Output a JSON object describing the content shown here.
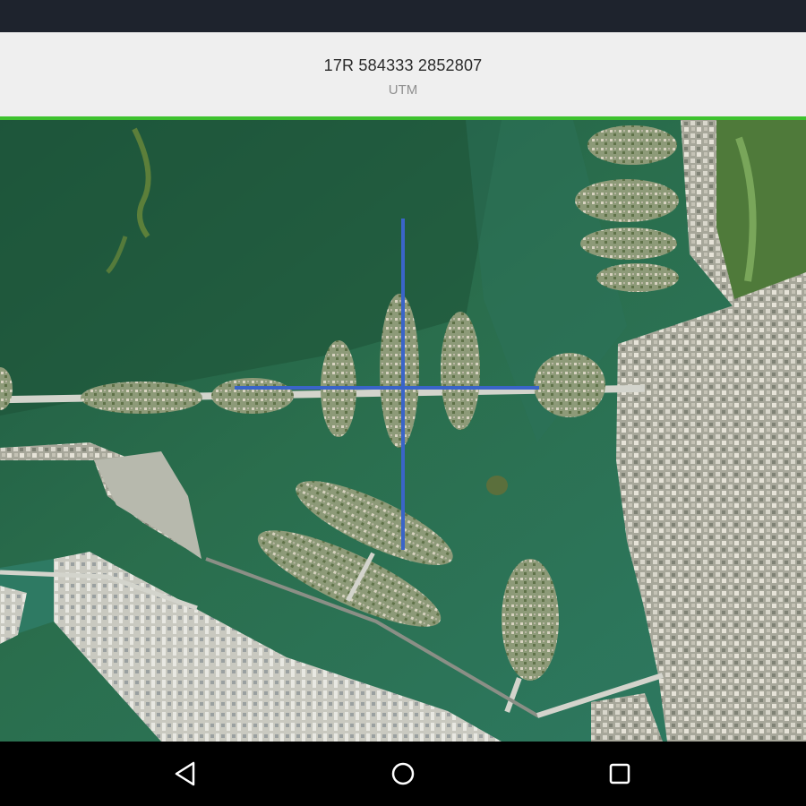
{
  "coordinates": {
    "value": "17R 584333 2852807",
    "system": "UTM"
  },
  "colors": {
    "accent": "#3ec22f",
    "crosshair": "#3a64c8",
    "status_bar": "#1e232d",
    "panel_bg": "#efefef"
  },
  "navigation": {
    "back_icon": "triangle-back-icon",
    "home_icon": "circle-home-icon",
    "recents_icon": "square-recents-icon"
  }
}
